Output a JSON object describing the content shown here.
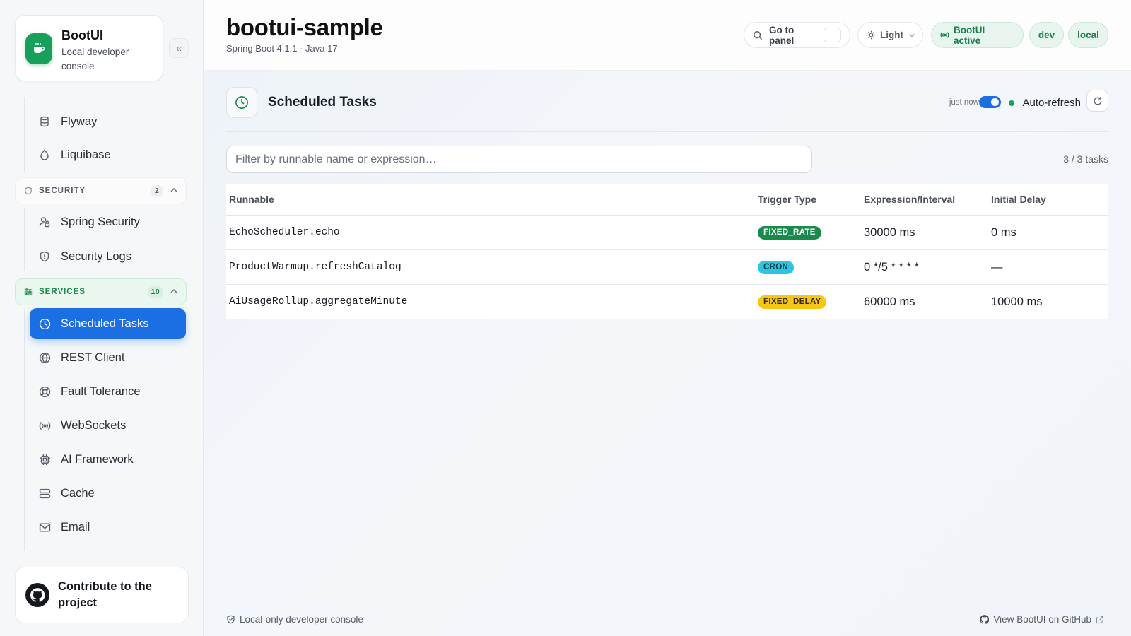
{
  "brand": {
    "title": "BootUI",
    "subtitle": "Local developer console"
  },
  "sidebar": {
    "top_items": [
      {
        "label": "Flyway",
        "icon": "database-icon"
      },
      {
        "label": "Liquibase",
        "icon": "droplet-icon"
      }
    ],
    "security": {
      "label": "SECURITY",
      "count": "2",
      "items": [
        {
          "label": "Spring Security",
          "icon": "user-lock-icon"
        },
        {
          "label": "Security Logs",
          "icon": "shield-icon"
        }
      ]
    },
    "services": {
      "label": "SERVICES",
      "count": "10",
      "items": [
        {
          "label": "Scheduled Tasks",
          "icon": "clock-icon",
          "active": true
        },
        {
          "label": "REST Client",
          "icon": "globe-icon"
        },
        {
          "label": "Fault Tolerance",
          "icon": "lifebuoy-icon"
        },
        {
          "label": "WebSockets",
          "icon": "broadcast-icon"
        },
        {
          "label": "AI Framework",
          "icon": "cpu-icon"
        },
        {
          "label": "Cache",
          "icon": "server-stack-icon"
        },
        {
          "label": "Email",
          "icon": "mail-icon"
        }
      ]
    },
    "contribute": "Contribute to the project"
  },
  "header": {
    "title": "bootui-sample",
    "subtitle": "Spring Boot 4.1.1 · Java 17",
    "search_label": "Go to panel",
    "theme_label": "Light",
    "status_label": "BootUI active",
    "profiles": [
      "dev",
      "local"
    ]
  },
  "section": {
    "title": "Scheduled Tasks",
    "last_updated": "just now",
    "auto_refresh_label": "Auto-refresh",
    "auto_refresh_on": true
  },
  "filter": {
    "placeholder": "Filter by runnable name or expression…",
    "value": ""
  },
  "task_count": "3 / 3 tasks",
  "table": {
    "columns": [
      "Runnable",
      "Trigger Type",
      "Expression/Interval",
      "Initial Delay"
    ],
    "rows": [
      {
        "runnable": "EchoScheduler.echo",
        "trigger": "FIXED_RATE",
        "expression": "30000 ms",
        "delay": "0 ms"
      },
      {
        "runnable": "ProductWarmup.refreshCatalog",
        "trigger": "CRON",
        "expression": "0 */5 * * * *",
        "delay": "—"
      },
      {
        "runnable": "AiUsageRollup.aggregateMinute",
        "trigger": "FIXED_DELAY",
        "expression": "60000 ms",
        "delay": "10000 ms"
      }
    ]
  },
  "badge_colors": {
    "FIXED_RATE": {
      "bg": "#1a8a4c",
      "fg": "#ffffff"
    },
    "CRON": {
      "bg": "#2fc4e0",
      "fg": "#0b3a45"
    },
    "FIXED_DELAY": {
      "bg": "#f5c518",
      "fg": "#3a2c00"
    }
  },
  "footer": {
    "left": "Local-only developer console",
    "right": "View BootUI on GitHub"
  },
  "colors": {
    "accent": "#1c6fe3",
    "brand": "#16a05a"
  }
}
